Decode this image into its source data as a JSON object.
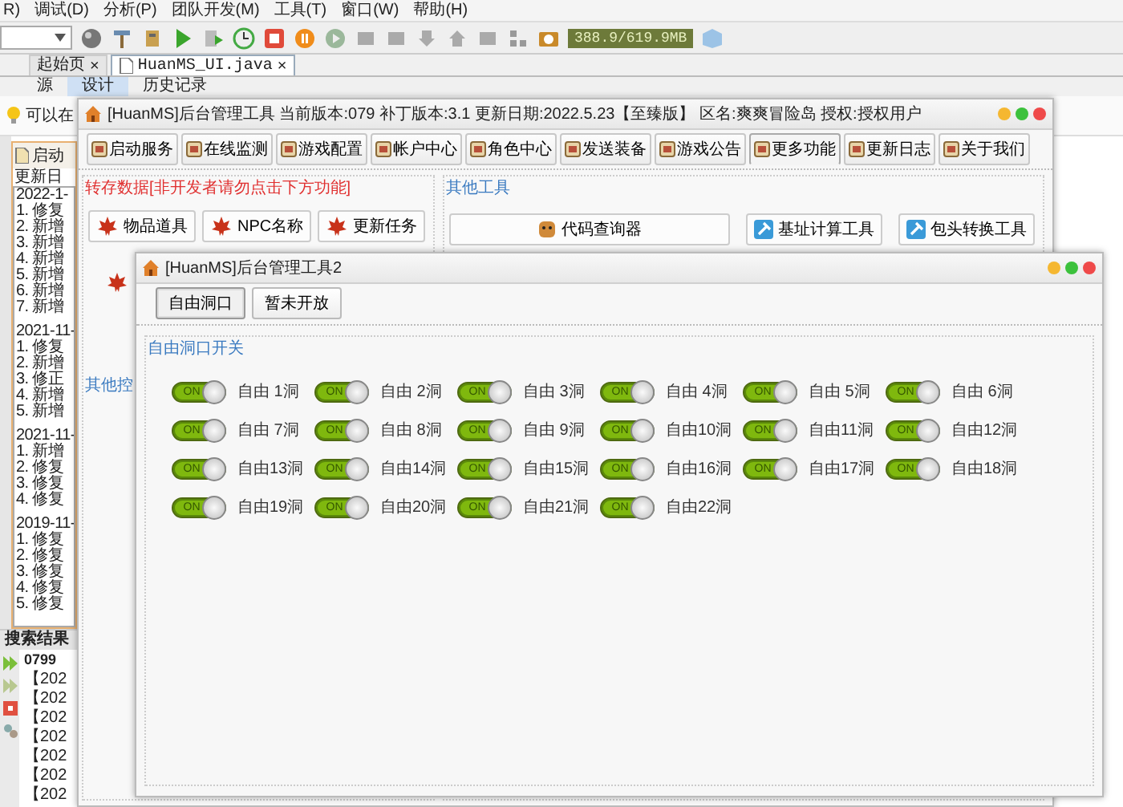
{
  "menu": [
    "R)",
    "调试(D)",
    "分析(P)",
    "团队开发(M)",
    "工具(T)",
    "窗口(W)",
    "帮助(H)"
  ],
  "memory": "388.9/619.9MB",
  "editor_tabs": [
    {
      "label": "起始页",
      "close": "×",
      "selected": false
    },
    {
      "label": "HuanMS_UI.java",
      "close": "×",
      "selected": true
    }
  ],
  "view_tabs": [
    {
      "label": "源",
      "selected": false
    },
    {
      "label": "设计",
      "selected": true
    },
    {
      "label": "历史记录",
      "selected": false
    }
  ],
  "hint": "可以在",
  "log_panel": {
    "title": "启动",
    "subtitle": "更新日",
    "entries": [
      {
        "date": "2022-1-",
        "items": [
          "1. 修复",
          "2. 新增",
          "3. 新增",
          "4. 新增",
          "5. 新增",
          "6. 新增",
          "7. 新增"
        ]
      },
      {
        "date": "2021-11-",
        "items": [
          "1. 修复",
          "2. 新增",
          "3. 修正",
          "4. 新增",
          "5. 新增"
        ]
      },
      {
        "date": "2021-11-",
        "items": [
          "1. 新增",
          "2. 修复",
          "3. 修复",
          "4. 修复"
        ]
      },
      {
        "date": "2019-11-",
        "items": [
          "1. 修复",
          "2. 修复",
          "3. 修复",
          "4. 修复",
          "5. 修复"
        ]
      }
    ]
  },
  "search_panel": {
    "title": "搜索结果",
    "heading": "0799",
    "lines": [
      "【202",
      "【202",
      "【202",
      "【202",
      "【202",
      "【202",
      "【202"
    ]
  },
  "window1": {
    "title": "[HuanMS]后台管理工具 当前版本:079 补丁版本:3.1 更新日期:2022.5.23【至臻版】 区名:爽爽冒险岛 授权:授权用户",
    "buttons": [
      {
        "label": "启动服务",
        "selected": false
      },
      {
        "label": "在线监测",
        "selected": false
      },
      {
        "label": "游戏配置",
        "selected": false
      },
      {
        "label": "帐户中心",
        "selected": false
      },
      {
        "label": "角色中心",
        "selected": false
      },
      {
        "label": "发送装备",
        "selected": false
      },
      {
        "label": "游戏公告",
        "selected": false
      },
      {
        "label": "更多功能",
        "selected": true
      },
      {
        "label": "更新日志",
        "selected": false
      },
      {
        "label": "关于我们",
        "selected": false
      }
    ],
    "left_group": {
      "title": "转存数据[非开发者请勿点击下方功能]",
      "buttons": [
        "物品道具",
        "NPC名称",
        "更新任务"
      ]
    },
    "right_group": {
      "title": "其他工具",
      "buttons": [
        "代码查询器",
        "基址计算工具",
        "包头转换工具"
      ]
    },
    "lower_group": {
      "title": "其他控"
    }
  },
  "window2": {
    "title": "[HuanMS]后台管理工具2",
    "tabs": [
      {
        "label": "自由洞口",
        "selected": true
      },
      {
        "label": "暂未开放",
        "selected": false
      }
    ],
    "group_title": "自由洞口开关",
    "switches": [
      {
        "label": "自由 1洞",
        "text": "ON",
        "on": true
      },
      {
        "label": "自由 2洞",
        "text": "ON",
        "on": true
      },
      {
        "label": "自由 3洞",
        "text": "ON",
        "on": true
      },
      {
        "label": "自由 4洞",
        "text": "ON",
        "on": true
      },
      {
        "label": "自由 5洞",
        "text": "ON",
        "on": true
      },
      {
        "label": "自由 6洞",
        "text": "ON",
        "on": true
      },
      {
        "label": "自由 7洞",
        "text": "ON",
        "on": true
      },
      {
        "label": "自由 8洞",
        "text": "ON",
        "on": true
      },
      {
        "label": "自由 9洞",
        "text": "ON",
        "on": true
      },
      {
        "label": "自由10洞",
        "text": "ON",
        "on": true
      },
      {
        "label": "自由11洞",
        "text": "ON",
        "on": true
      },
      {
        "label": "自由12洞",
        "text": "ON",
        "on": true
      },
      {
        "label": "自由13洞",
        "text": "ON",
        "on": true
      },
      {
        "label": "自由14洞",
        "text": "ON",
        "on": true
      },
      {
        "label": "自由15洞",
        "text": "ON",
        "on": true
      },
      {
        "label": "自由16洞",
        "text": "ON",
        "on": true
      },
      {
        "label": "自由17洞",
        "text": "ON",
        "on": true
      },
      {
        "label": "自由18洞",
        "text": "ON",
        "on": true
      },
      {
        "label": "自由19洞",
        "text": "ON",
        "on": true
      },
      {
        "label": "自由20洞",
        "text": "ON",
        "on": true
      },
      {
        "label": "自由21洞",
        "text": "ON",
        "on": true
      },
      {
        "label": "自由22洞",
        "text": "ON",
        "on": true
      }
    ]
  }
}
